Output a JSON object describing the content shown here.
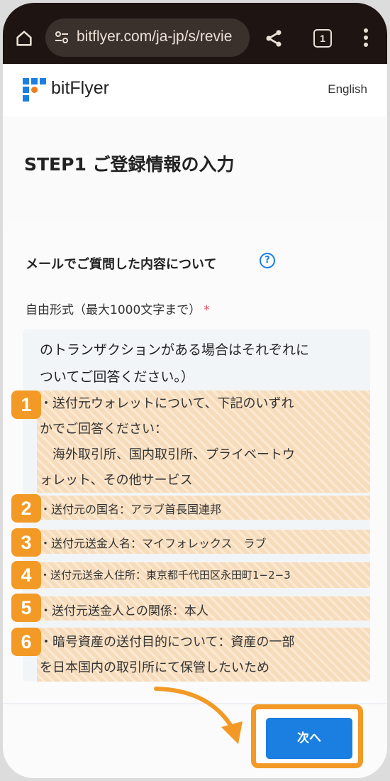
{
  "browser": {
    "url": "bitflyer.com/ja-jp/s/revie",
    "tab_count": "1",
    "icons": [
      "home-icon",
      "tune-icon",
      "share-icon",
      "tabs-icon",
      "more-vert-icon"
    ]
  },
  "site": {
    "brand": "bitFlyer",
    "language_link": "English",
    "brand_colors": {
      "blue": "#1a7fe0",
      "orange": "#f29a25"
    }
  },
  "page": {
    "title": "STEP1 ご登録情報の入力"
  },
  "form": {
    "section_title": "メールでご質問した内容について",
    "help_icon": "?",
    "field_label": "自由形式（最大1000文字まで）",
    "required_mark": "*",
    "textarea_lines": [
      "のトランザクションがある場合はそれぞれに",
      "ついてご回答ください。）"
    ],
    "highlights": [
      {
        "badge": "1",
        "lines": [
          "・送付元ウォレットについて、下記のいずれ",
          "かでご回答ください：",
          "　海外取引所、国内取引所、プライベートウ",
          "ォレット、その他サービス"
        ]
      },
      {
        "badge": "2",
        "lines": [
          "・送付元の国名：アラブ首長国連邦"
        ]
      },
      {
        "badge": "3",
        "lines": [
          "・送付元送金人名：マイフォレックス　ラブ"
        ]
      },
      {
        "badge": "4",
        "lines": [
          "・送付元送金人住所：東京都千代田区永田町1−2−3"
        ]
      },
      {
        "badge": "5",
        "lines": [
          "・送付元送金人との関係：本人"
        ]
      },
      {
        "badge": "6",
        "lines": [
          "・暗号資産の送付目的について：資産の一部",
          "を日本国内の取引所にて保管したいため"
        ]
      }
    ]
  },
  "footer": {
    "next_label": "次へ"
  }
}
